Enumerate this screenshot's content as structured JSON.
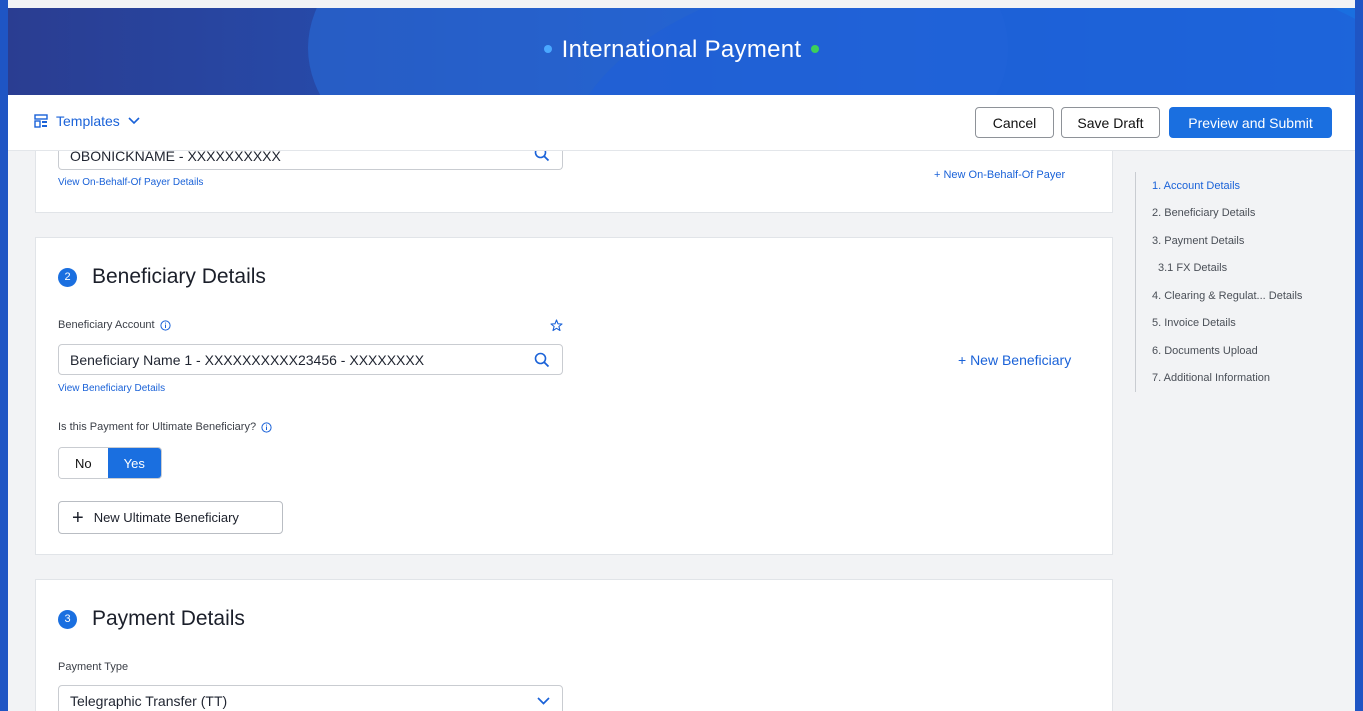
{
  "header": {
    "title": "International Payment"
  },
  "toolbar": {
    "templates_label": "Templates",
    "cancel_label": "Cancel",
    "save_draft_label": "Save Draft",
    "submit_label": "Preview and Submit"
  },
  "account_section": {
    "obo_value": "OBONICKNAME - XXXXXXXXXX",
    "view_obo_link": "View On-Behalf-Of Payer Details",
    "new_obo_link": "+ New On-Behalf-Of Payer"
  },
  "beneficiary_section": {
    "number": "2",
    "title": "Beneficiary Details",
    "account_label": "Beneficiary Account",
    "account_value": "Beneficiary Name 1 - XXXXXXXXXX23456 - XXXXXXXX",
    "view_link": "View Beneficiary Details",
    "new_beneficiary_link": "+  New Beneficiary",
    "ultimate_question": "Is this Payment for Ultimate Beneficiary?",
    "toggle_no": "No",
    "toggle_yes": "Yes",
    "new_ultimate_label": "New Ultimate Beneficiary"
  },
  "payment_section": {
    "number": "3",
    "title": "Payment Details",
    "payment_type_label": "Payment Type",
    "payment_type_value": "Telegraphic Transfer (TT)"
  },
  "side_nav": {
    "items": [
      {
        "label": "1. Account Details"
      },
      {
        "label": "2. Beneficiary Details"
      },
      {
        "label": "3. Payment Details"
      },
      {
        "label": "3.1 FX Details"
      },
      {
        "label": "4. Clearing & Regulat... Details"
      },
      {
        "label": "5. Invoice Details"
      },
      {
        "label": "6. Documents Upload"
      },
      {
        "label": "7. Additional Information"
      }
    ]
  },
  "colors": {
    "accent": "#1a6fe0",
    "banner_dark": "#2a3d91",
    "dot_blue": "#4aa8ff",
    "dot_green": "#3cd05a"
  }
}
